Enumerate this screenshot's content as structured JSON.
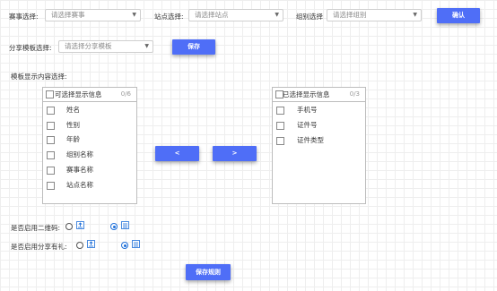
{
  "filters": {
    "event_label": "赛事选择:",
    "event_placeholder": "请选择赛事",
    "site_label": "站点选择:",
    "site_placeholder": "请选择站点",
    "group_label": "组别选择",
    "group_placeholder": "请选择组别",
    "confirm_label": "确认"
  },
  "template": {
    "label": "分享模板选择:",
    "placeholder": "请选择分享模板",
    "save_label": "保存"
  },
  "content_section_label": "模板显示内容选择:",
  "available": {
    "title": "可选择显示信息",
    "count": "0/6",
    "items": [
      "姓名",
      "性别",
      "年龄",
      "组别名称",
      "赛事名称",
      "站点名称"
    ]
  },
  "selected": {
    "title": "已选择显示信息",
    "count": "0/3",
    "items": [
      "手机号",
      "证件号",
      "证件类型"
    ]
  },
  "transfer": {
    "left_label": "<",
    "right_label": ">"
  },
  "options": {
    "qrcode_label": "是否启用二维码:",
    "gift_label": "是否启用分享有礼:",
    "yes_icon": "upload-icon",
    "no_icon": "no-text-icon",
    "qrcode_value": "no",
    "gift_value": "no"
  },
  "save_rules_label": "保存规则",
  "colors": {
    "accent": "#4f6ef7",
    "radio_selected": "#1e6fd9"
  }
}
